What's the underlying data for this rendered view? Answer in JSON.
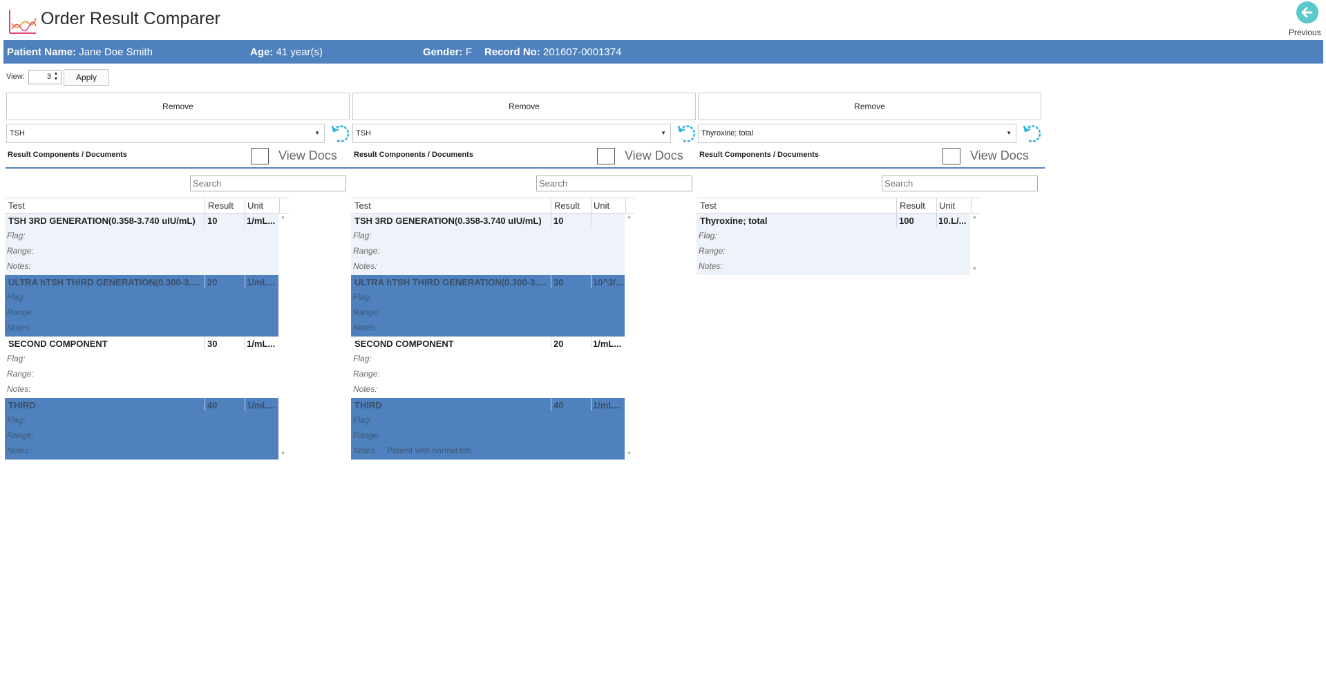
{
  "app": {
    "title": "Order Result Comparer",
    "previous_label": "Previous"
  },
  "patient": {
    "name_label": "Patient Name:",
    "name": "Jane Doe Smith",
    "age_label": "Age:",
    "age": "41 year(s)",
    "gender_label": "Gender:",
    "gender": "F",
    "record_label": "Record No:",
    "record": "201607-0001374"
  },
  "view": {
    "label": "View:",
    "value": "3",
    "apply_label": "Apply"
  },
  "columns": [
    {
      "remove_label": "Remove",
      "order": "TSH",
      "section_label": "Result Components / Documents",
      "view_docs_label": "View Docs",
      "search_placeholder": "Search",
      "headers": {
        "test": "Test",
        "result": "Result",
        "unit": "Unit"
      },
      "rows": [
        {
          "test": "TSH 3RD GENERATION(0.358-3.740 uIU/mL)",
          "result": "10",
          "unit": "1/mL...",
          "flag": "Flag:",
          "range": "Range:",
          "notes": "Notes:",
          "notes_value": ""
        },
        {
          "test": "ULTRA hTSH THIRD GENERATION(0.300-3.000 uIU/...",
          "result": "20",
          "unit": "1/mL...",
          "flag": "Flag:",
          "range": "Range:",
          "notes": "Notes:",
          "notes_value": ""
        },
        {
          "test": "SECOND COMPONENT",
          "result": "30",
          "unit": "1/mL...",
          "flag": "Flag:",
          "range": "Range:",
          "notes": "Notes:",
          "notes_value": ""
        },
        {
          "test": "THIRD",
          "result": "40",
          "unit": "1/mL...",
          "flag": "Flag:",
          "range": "Range:",
          "notes": "Notes:",
          "notes_value": ""
        }
      ]
    },
    {
      "remove_label": "Remove",
      "order": "TSH",
      "section_label": "Result Components / Documents",
      "view_docs_label": "View Docs",
      "search_placeholder": "Search",
      "headers": {
        "test": "Test",
        "result": "Result",
        "unit": "Unit"
      },
      "rows": [
        {
          "test": "TSH 3RD GENERATION(0.358-3.740 uIU/mL)",
          "result": "10",
          "unit": "",
          "flag": "Flag:",
          "range": "Range:",
          "notes": "Notes:",
          "notes_value": ""
        },
        {
          "test": "ULTRA hTSH THIRD GENERATION(0.300-3.000 uIU/...",
          "result": "30",
          "unit": "10^3/...",
          "flag": "Flag:",
          "range": "Range:",
          "notes": "Notes:",
          "notes_value": ""
        },
        {
          "test": "SECOND COMPONENT",
          "result": "20",
          "unit": "1/mL...",
          "flag": "Flag:",
          "range": "Range:",
          "notes": "Notes:",
          "notes_value": ""
        },
        {
          "test": "THIRD",
          "result": "40",
          "unit": "1/mL...",
          "flag": "Flag:",
          "range": "Range:",
          "notes": "Notes:",
          "notes_value": "Patient with normal tsh."
        }
      ]
    },
    {
      "remove_label": "Remove",
      "order": "Thyroxine; total",
      "section_label": "Result Components / Documents",
      "view_docs_label": "View Docs",
      "search_placeholder": "Search",
      "headers": {
        "test": "Test",
        "result": "Result",
        "unit": "Unit"
      },
      "rows": [
        {
          "test": "Thyroxine; total",
          "result": "100",
          "unit": "10.L/...",
          "flag": "Flag:",
          "range": "Range:",
          "notes": "Notes:",
          "notes_value": ""
        }
      ]
    }
  ],
  "colors": {
    "accent": "#4e81bd",
    "row_light": "#eef3fa",
    "refresh": "#2ab4e0",
    "previous": "#5bc9c9"
  },
  "icons": [
    "chart-logo-icon",
    "back-arrow-icon",
    "refresh-icon",
    "dropdown-arrow-icon",
    "scroll-up-icon",
    "scroll-down-icon"
  ]
}
